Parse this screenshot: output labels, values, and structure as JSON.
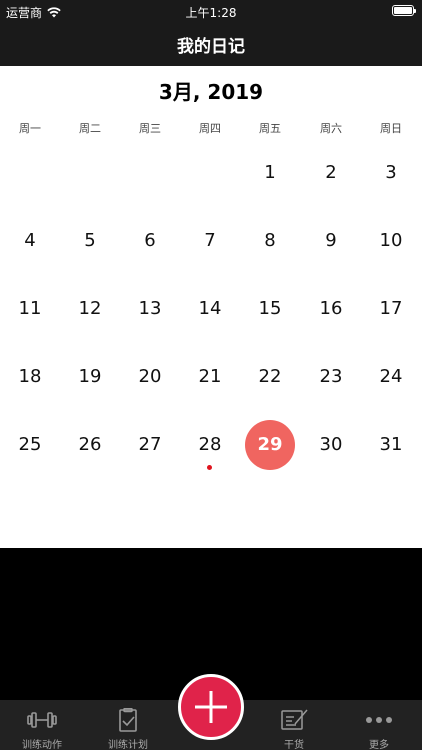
{
  "status_bar": {
    "carrier": "运营商",
    "time": "上午1:28"
  },
  "nav": {
    "title": "我的日记"
  },
  "calendar": {
    "month_label": "3月, 2019",
    "weekdays": [
      "周一",
      "周二",
      "周三",
      "周四",
      "周五",
      "周六",
      "周日"
    ],
    "weeks": [
      [
        "",
        "",
        "",
        "",
        "1",
        "2",
        "3"
      ],
      [
        "4",
        "5",
        "6",
        "7",
        "8",
        "9",
        "10"
      ],
      [
        "11",
        "12",
        "13",
        "14",
        "15",
        "16",
        "17"
      ],
      [
        "18",
        "19",
        "20",
        "21",
        "22",
        "23",
        "24"
      ],
      [
        "25",
        "26",
        "27",
        "28",
        "29",
        "30",
        "31"
      ]
    ],
    "selected_day": "29",
    "marked_days": [
      "28"
    ],
    "selected_color": "#f06560",
    "marker_color": "#e0141e"
  },
  "tab_bar": {
    "tabs": [
      {
        "label": "训练动作",
        "icon": "dumbbell-icon"
      },
      {
        "label": "训练计划",
        "icon": "clipboard-check-icon"
      },
      {
        "label": "干货",
        "icon": "article-edit-icon"
      },
      {
        "label": "更多",
        "icon": "more-dots-icon"
      }
    ],
    "add_button": {
      "icon": "plus-icon",
      "color": "#e0234a"
    }
  }
}
